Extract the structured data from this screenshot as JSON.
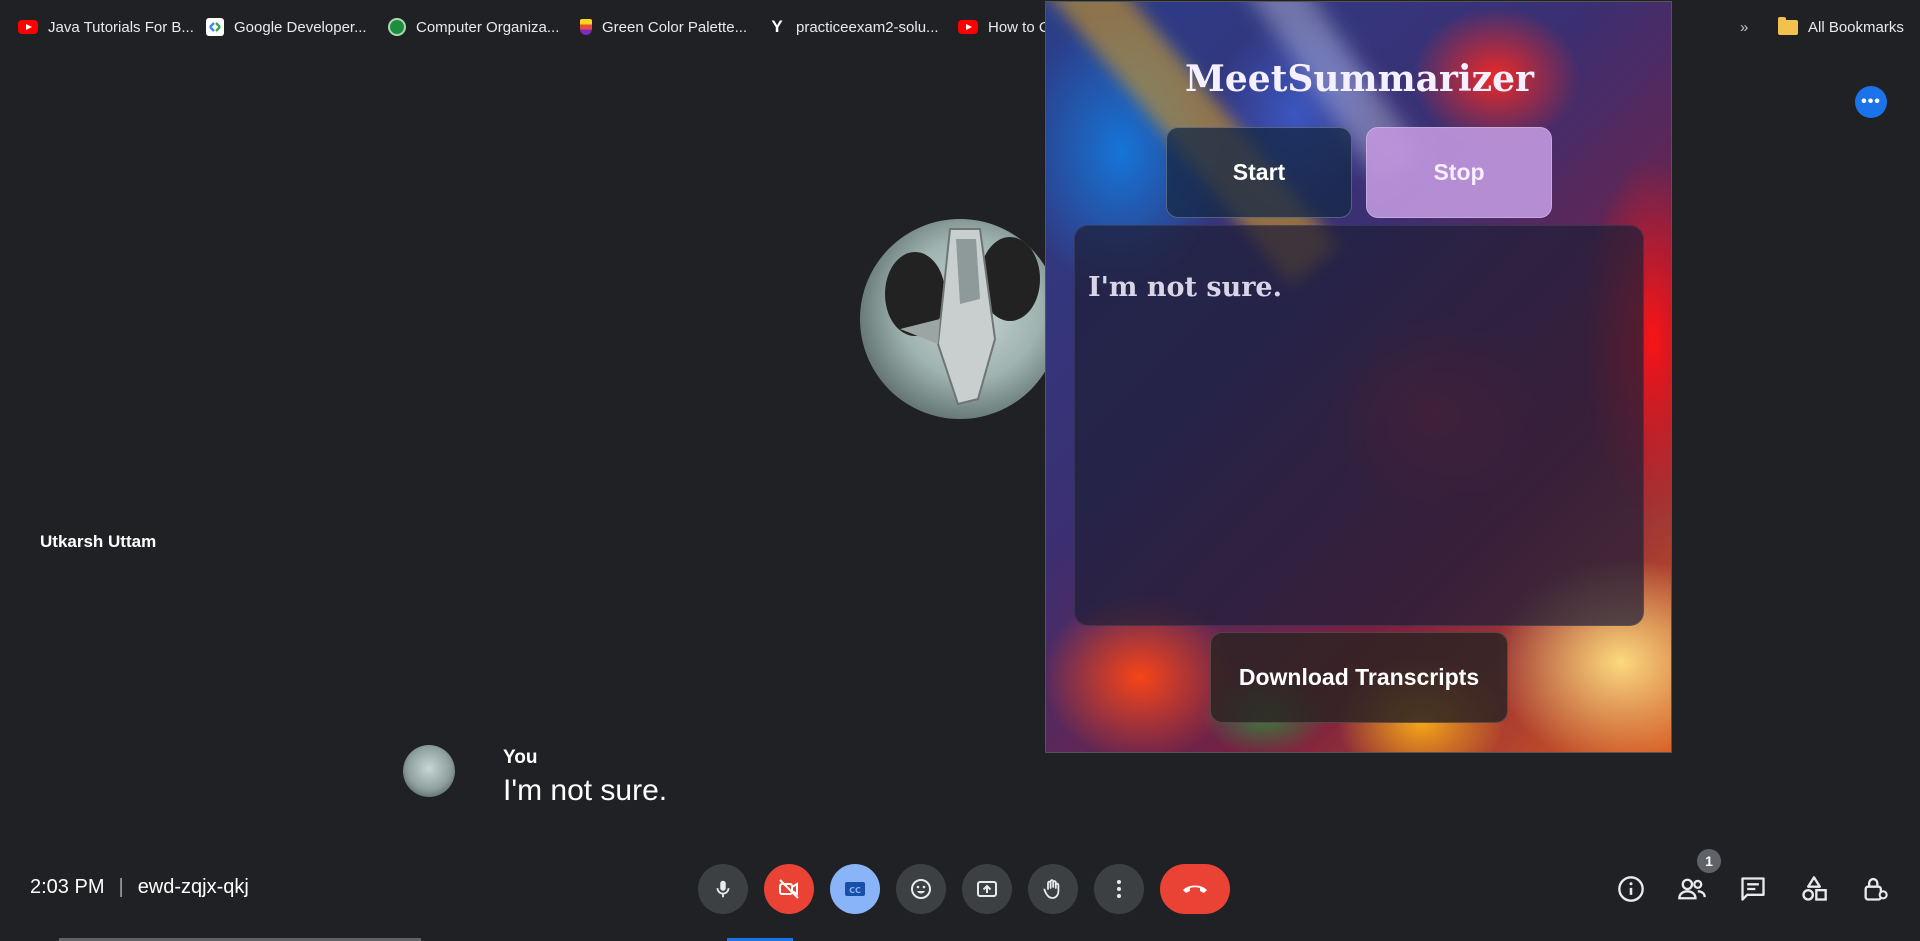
{
  "bookmarks": {
    "items": [
      {
        "label": "Java Tutorials For B...",
        "icon": "youtube-icon"
      },
      {
        "label": "Google Developer...",
        "icon": "google-developers-icon"
      },
      {
        "label": "Computer Organiza...",
        "icon": "course-icon"
      },
      {
        "label": "Green Color Palette...",
        "icon": "palette-icon"
      },
      {
        "label": "practiceexam2-solu...",
        "icon": "y-icon"
      },
      {
        "label": "How to C",
        "icon": "youtube-icon"
      }
    ],
    "overflow": "»",
    "all_bookmarks": "All Bookmarks"
  },
  "meet": {
    "more_options": "•••",
    "participant_name": "Utkarsh Uttam",
    "caption": {
      "speaker": "You",
      "text": "I'm not sure."
    },
    "time": "2:03 PM",
    "separator": "|",
    "meeting_code": "ewd-zqjx-qkj",
    "participants_count": "1"
  },
  "extension": {
    "title": "MeetSummarizer",
    "start_label": "Start",
    "stop_label": "Stop",
    "transcript": "I'm not sure.",
    "download_label": "Download Transcripts"
  },
  "colors": {
    "background": "#202124",
    "end_call": "#ea4335",
    "captions_active": "#8ab4f8",
    "accent_blue": "#1a73e8"
  }
}
